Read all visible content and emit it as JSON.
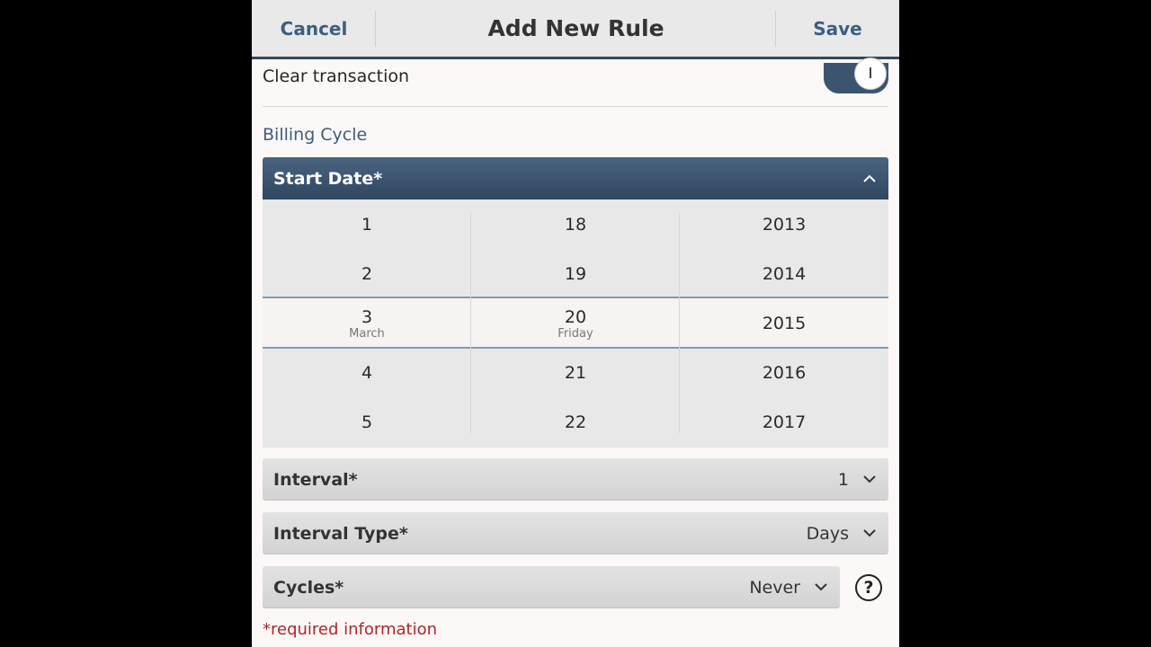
{
  "titlebar": {
    "cancel_label": "Cancel",
    "title": "Add New Rule",
    "save_label": "Save"
  },
  "clear_transaction": {
    "label": "Clear transaction",
    "toggle_on": true
  },
  "billing_cycle": {
    "section_title": "Billing Cycle",
    "start_date": {
      "label": "Start Date*",
      "expanded": true,
      "months": [
        "1",
        "2",
        "3",
        "4",
        "5"
      ],
      "days": [
        "18",
        "19",
        "20",
        "21",
        "22"
      ],
      "years": [
        "2013",
        "2014",
        "2015",
        "2016",
        "2017"
      ],
      "selected": {
        "month": "3",
        "month_name": "March",
        "day": "20",
        "weekday": "Friday",
        "year": "2015"
      }
    },
    "interval": {
      "label": "Interval*",
      "value": "1"
    },
    "interval_type": {
      "label": "Interval Type*",
      "value": "Days"
    },
    "cycles": {
      "label": "Cycles*",
      "value": "Never"
    },
    "help_label": "?"
  },
  "required_note": "*required information",
  "colors": {
    "accent": "#3c5e80",
    "header_dark": "#2f4660",
    "required_red": "#b32424"
  }
}
